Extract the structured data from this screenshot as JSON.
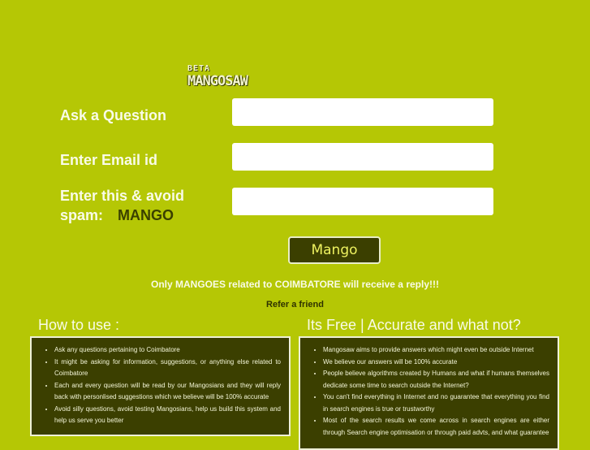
{
  "logo": {
    "beta": "BETA",
    "name": "MANGOSAW"
  },
  "form": {
    "question_label": "Ask a Question",
    "email_label": "Enter Email id",
    "captcha_label_line1": "Enter this & avoid",
    "captcha_label_line2": "spam:",
    "captcha_word": "MANGO",
    "question_value": "",
    "email_value": "",
    "captcha_value": "",
    "submit_label": "Mango"
  },
  "notice": "Only MANGOES related to COIMBATORE will receive a reply!!!",
  "refer_link": "Refer a friend",
  "how_to_use": {
    "title": "How to use :",
    "items": [
      "Ask any questions pertaining to Coimbatore",
      "It might be asking for information, suggestions, or anything else related to Coimbatore",
      "Each and every question will be read by our Mangosians and they will reply back with personlised suggestions which we believe will be 100% accurate",
      "Avoid silly questions, avoid testing Mangosians, help us build this system and help us serve you better"
    ]
  },
  "its_free": {
    "title": "Its Free | Accurate and what not?",
    "items": [
      "Mangosaw aims to provide answers which might even be outside Internet",
      "We believe our answers will be 100% accurate",
      "People believe algorithms created by Humans and what if humans themselves dedicate some time to search outside the Internet?",
      "You can't find everything in Internet and no guarantee that everything you find in search engines is true or trustworthy",
      "Most of the search results we come across in search engines are either through Search engine optimisation or through paid advts, and what guarantee"
    ]
  },
  "colors": {
    "background": "#b5c705",
    "panel": "#3b3f00",
    "text_light": "#f9fbe8",
    "button_text": "#eef260"
  }
}
